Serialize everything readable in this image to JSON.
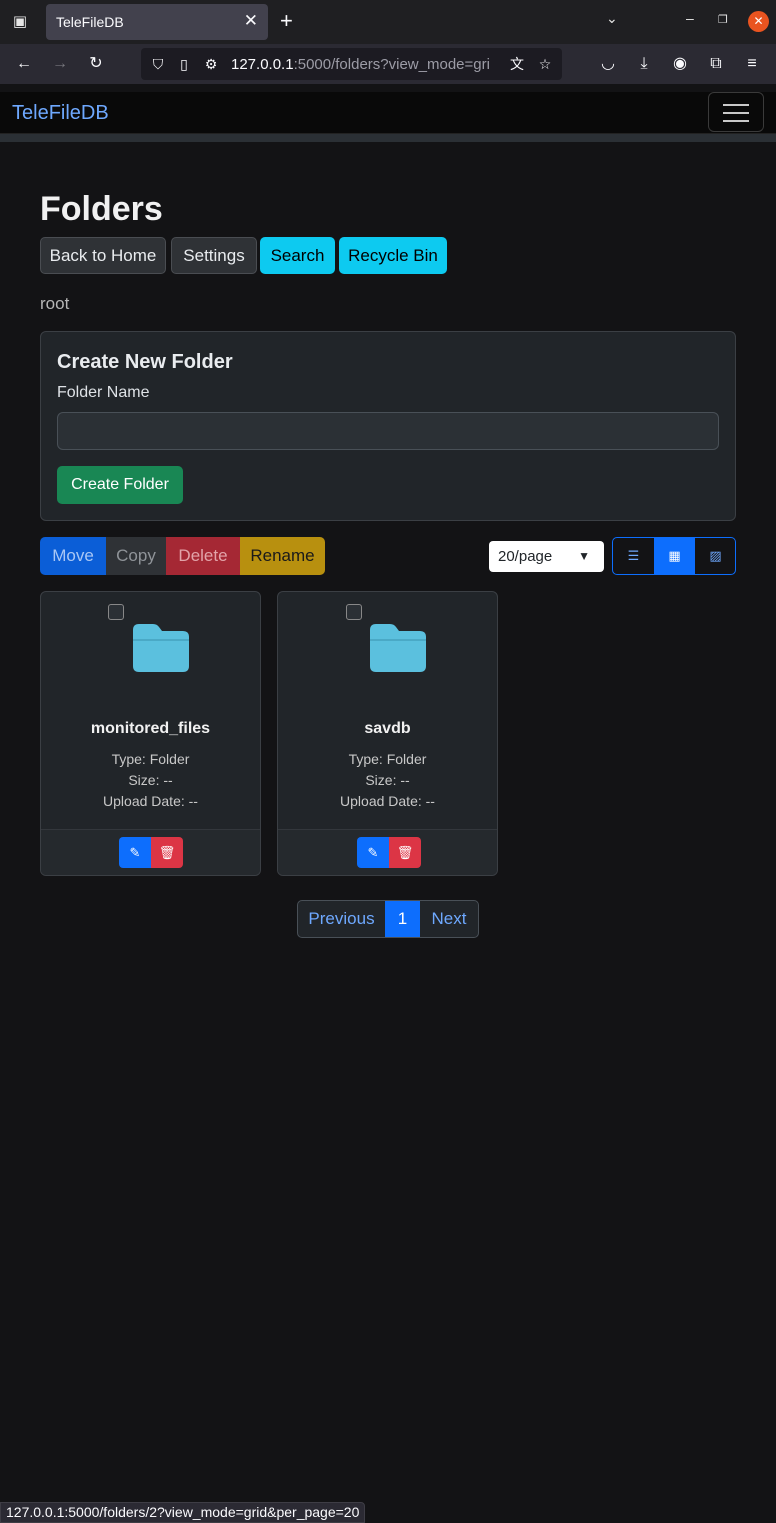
{
  "browser": {
    "tab_title": "TeleFileDB",
    "url_host": "127.0.0.1",
    "url_rest": ":5000/folders?view_mode=gri",
    "status_url": "127.0.0.1:5000/folders/2?view_mode=grid&per_page=20"
  },
  "app": {
    "brand": "TeleFileDB"
  },
  "page": {
    "title": "Folders",
    "nav_buttons": [
      "Back to Home",
      "Settings",
      "Search",
      "Recycle Bin"
    ],
    "breadcrumb": "root"
  },
  "create_folder": {
    "title": "Create New Folder",
    "label": "Folder Name",
    "value": "",
    "placeholder": "",
    "button": "Create Folder"
  },
  "actions": {
    "move": "Move",
    "copy": "Copy",
    "delete": "Delete",
    "rename": "Rename"
  },
  "per_page": {
    "selected": "20/page"
  },
  "view_modes": {
    "active": "grid",
    "options": [
      "list",
      "grid",
      "gallery"
    ]
  },
  "folders": [
    {
      "name": "monitored_files",
      "type": "Type: Folder",
      "size": "Size: --",
      "upload_date": "Upload Date: --"
    },
    {
      "name": "savdb",
      "type": "Type: Folder",
      "size": "Size: --",
      "upload_date": "Upload Date: --"
    }
  ],
  "pagination": {
    "previous": "Previous",
    "current": "1",
    "next": "Next"
  },
  "colors": {
    "accent": "#0d6efd",
    "info": "#0dcaf0",
    "success": "#198754",
    "danger": "#dc3545",
    "warning": "#b8900f",
    "folder": "#5bc0de"
  }
}
